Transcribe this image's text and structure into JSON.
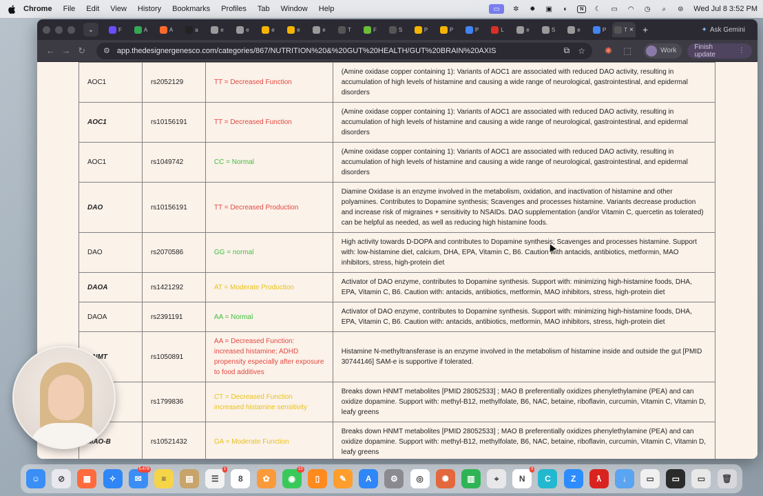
{
  "menubar": {
    "app": "Chrome",
    "items": [
      "File",
      "Edit",
      "View",
      "History",
      "Bookmarks",
      "Profiles",
      "Tab",
      "Window",
      "Help"
    ],
    "clock": "Wed Jul 8  3:52 PM"
  },
  "browser": {
    "gemini_label": "Ask Gemini",
    "url": "app.thedesignergenesco.com/categories/867/NUTRITION%20&%20GUT%20HEALTH/GUT%20BRAIN%20AXIS",
    "profile_label": "Work",
    "finish_update_label": "Finish update",
    "tabs": [
      {
        "label": "F",
        "color": "#6b4cff"
      },
      {
        "label": "A",
        "color": "#34a853"
      },
      {
        "label": "A",
        "color": "#ff6a2c"
      },
      {
        "label": "a",
        "color": "#222222"
      },
      {
        "label": "e",
        "color": "#9a9a9a"
      },
      {
        "label": "e",
        "color": "#9a9a9a"
      },
      {
        "label": "e",
        "color": "#f4b400"
      },
      {
        "label": "e",
        "color": "#f4b400"
      },
      {
        "label": "e",
        "color": "#9a9a9a"
      },
      {
        "label": "T",
        "color": "#555555"
      },
      {
        "label": "F",
        "color": "#6abf3a"
      },
      {
        "label": "S",
        "color": "#555555"
      },
      {
        "label": "P",
        "color": "#f4b400"
      },
      {
        "label": "P",
        "color": "#f4b400"
      },
      {
        "label": "P",
        "color": "#4285f4"
      },
      {
        "label": "L",
        "color": "#d93025"
      },
      {
        "label": "e",
        "color": "#9a9a9a"
      },
      {
        "label": "S",
        "color": "#9a9a9a"
      },
      {
        "label": "e",
        "color": "#9a9a9a"
      },
      {
        "label": "P",
        "color": "#4285f4"
      },
      {
        "label": "T",
        "color": "#555555"
      }
    ]
  },
  "table": {
    "rows": [
      {
        "gene": "AOC1",
        "gene_bold": false,
        "rsid": "rs2052129",
        "genotype": "TT = Decreased Function",
        "genotype_color": "red",
        "description": "(Amine oxidase copper containing 1): Variants of AOC1 are associated with reduced DAO activity, resulting in accumulation of high levels of histamine and causing a wide range of neurological, gastrointestinal, and epidermal disorders"
      },
      {
        "gene": "AOC1",
        "gene_bold": true,
        "rsid": "rs10156191",
        "genotype": "TT = Decreased Function",
        "genotype_color": "red",
        "description": "(Amine oxidase copper containing 1): Variants of AOC1 are associated with reduced DAO activity, resulting in accumulation of high levels of histamine and causing a wide range of neurological, gastrointestinal, and epidermal disorders"
      },
      {
        "gene": "AOC1",
        "gene_bold": false,
        "rsid": "rs1049742",
        "genotype": "CC = Normal",
        "genotype_color": "green",
        "description": "(Amine oxidase copper containing 1): Variants of AOC1 are associated with reduced DAO activity, resulting in accumulation of high levels of histamine and causing a wide range of neurological, gastrointestinal, and epidermal disorders"
      },
      {
        "gene": "DAO",
        "gene_bold": true,
        "rsid": "rs10156191",
        "genotype": "TT = Decreased Production",
        "genotype_color": "red",
        "description": "Diamine Oxidase is an enzyme involved in the metabolism, oxidation, and inactivation of histamine and other polyamines. Contributes to Dopamine synthesis; Scavenges and processes histamine. Variants decrease production and increase risk of migraines + sensitivity to NSAIDs. DAO supplementation (and/or Vitamin C, quercetin as tolerated) can be helpful as needed, as well as reducing high histamine foods."
      },
      {
        "gene": "DAO",
        "gene_bold": false,
        "rsid": "rs2070586",
        "genotype": "GG = normal",
        "genotype_color": "green",
        "description": "High activity towards D-DOPA and contributes to Dopamine synthesis; Scavenges and processes histamine. Support with: low-histamine diet, calcium, DHA, EPA, Vitamin C, B6. Caution with antacids, antibiotics, metformin, MAO inhibitors, stress, high-protein diet"
      },
      {
        "gene": "DAOA",
        "gene_bold": true,
        "rsid": "rs1421292",
        "genotype": "AT = Moderate Production",
        "genotype_color": "yellow",
        "description": "Activator of DAO enzyme, contributes to Dopamine synthesis. Support with: minimizing high-histamine foods, DHA, EPA, Vitamin C, B6. Caution with: antacids, antibiotics, metformin, MAO inhibitors, stress, high-protein diet"
      },
      {
        "gene": "DAOA",
        "gene_bold": false,
        "rsid": "rs2391191",
        "genotype": "AA = Normal",
        "genotype_color": "green",
        "description": "Activator of DAO enzyme, contributes to Dopamine synthesis. Support with: minimizing high-histamine foods, DHA, EPA, Vitamin C, B6. Caution with: antacids, antibiotics, metformin, MAO inhibitors, stress, high-protein diet"
      },
      {
        "gene": "HNMT",
        "gene_bold": true,
        "rsid": "rs1050891",
        "genotype": "AA = Decreased Function: increased histamine; ADHD propensity especially after exposure to food additives",
        "genotype_color": "red",
        "description": "Histamine N-methyltransferase is an enzyme involved in the metabolism of histamine inside and outside the gut [PMID 30744146] SAM-e is supportive if tolerated."
      },
      {
        "gene": "",
        "gene_bold": false,
        "rsid": "rs1799836",
        "genotype": "CT = Decreased Function increased histamine sensitivity",
        "genotype_color": "yellow",
        "description": "Breaks down HNMT metabolites [PMID 28052533] ; MAO B preferentially oxidizes phenylethylamine (PEA) and can oxidize dopamine. Support with: methyl-B12, methylfolate, B6, NAC, betaine, riboflavin, curcumin, Vitamin C, Vitamin D, leafy greens"
      },
      {
        "gene": "MAO-B",
        "gene_bold": true,
        "rsid": "rs10521432",
        "genotype": "GA = Moderate Function",
        "genotype_color": "yellow",
        "description": "Breaks down HNMT metabolites [PMID 28052533] ; MAO B preferentially oxidizes phenylethylamine (PEA) and can oxidize dopamine. Support with: methyl-B12, methylfolate, B6, NAC, betaine, riboflavin, curcumin, Vitamin C, Vitamin D, leafy greens"
      }
    ]
  },
  "dock": {
    "apps": [
      {
        "name": "finder",
        "color": "#3a8ef6",
        "glyph": "☺",
        "badge": ""
      },
      {
        "name": "launchpad",
        "color": "#e8e8ee",
        "glyph": "⊘",
        "badge": ""
      },
      {
        "name": "apps-grid",
        "color": "#ff6b3d",
        "glyph": "▦",
        "badge": ""
      },
      {
        "name": "safari",
        "color": "#2f86f6",
        "glyph": "✧",
        "badge": ""
      },
      {
        "name": "mail",
        "color": "#3a8ef6",
        "glyph": "✉",
        "badge": "5,478"
      },
      {
        "name": "notes",
        "color": "#f5d547",
        "glyph": "≡",
        "badge": ""
      },
      {
        "name": "finder-folder",
        "color": "#c8a46a",
        "glyph": "▤",
        "badge": ""
      },
      {
        "name": "reminders",
        "color": "#f2f2f2",
        "glyph": "☰",
        "badge": "1"
      },
      {
        "name": "calendar",
        "color": "#ffffff",
        "glyph": "8",
        "badge": ""
      },
      {
        "name": "photos",
        "color": "#fa9a3a",
        "glyph": "✿",
        "badge": ""
      },
      {
        "name": "messages",
        "color": "#39c95a",
        "glyph": "◉",
        "badge": "15"
      },
      {
        "name": "books",
        "color": "#ff8a1e",
        "glyph": "▯",
        "badge": ""
      },
      {
        "name": "pages",
        "color": "#ff9e2c",
        "glyph": "✎",
        "badge": ""
      },
      {
        "name": "app-store",
        "color": "#2f86f6",
        "glyph": "A",
        "badge": ""
      },
      {
        "name": "settings",
        "color": "#8a8a90",
        "glyph": "⚙",
        "badge": ""
      },
      {
        "name": "chrome",
        "color": "#ffffff",
        "glyph": "◎",
        "badge": ""
      },
      {
        "name": "claude",
        "color": "#e4683d",
        "glyph": "✺",
        "badge": ""
      },
      {
        "name": "numbers",
        "color": "#2fb455",
        "glyph": "▥",
        "badge": ""
      },
      {
        "name": "compass",
        "color": "#e8e8ea",
        "glyph": "⌖",
        "badge": ""
      },
      {
        "name": "notion",
        "color": "#ffffff",
        "glyph": "N",
        "badge": "3"
      },
      {
        "name": "canva",
        "color": "#22b8cf",
        "glyph": "C",
        "badge": ""
      },
      {
        "name": "zoom",
        "color": "#2d8cff",
        "glyph": "Z",
        "badge": ""
      },
      {
        "name": "acrobat",
        "color": "#d9231f",
        "glyph": "ƛ",
        "badge": ""
      },
      {
        "name": "downloads",
        "color": "#5aa4f2",
        "glyph": "↓",
        "badge": ""
      },
      {
        "name": "document-1",
        "color": "#f0f0f0",
        "glyph": "▭",
        "badge": ""
      },
      {
        "name": "document-2",
        "color": "#2b2b2b",
        "glyph": "▭",
        "badge": ""
      },
      {
        "name": "document-3",
        "color": "#e8e8e8",
        "glyph": "▭",
        "badge": ""
      },
      {
        "name": "trash",
        "color": "#d8d8dc",
        "glyph": "🗑",
        "badge": ""
      }
    ]
  }
}
